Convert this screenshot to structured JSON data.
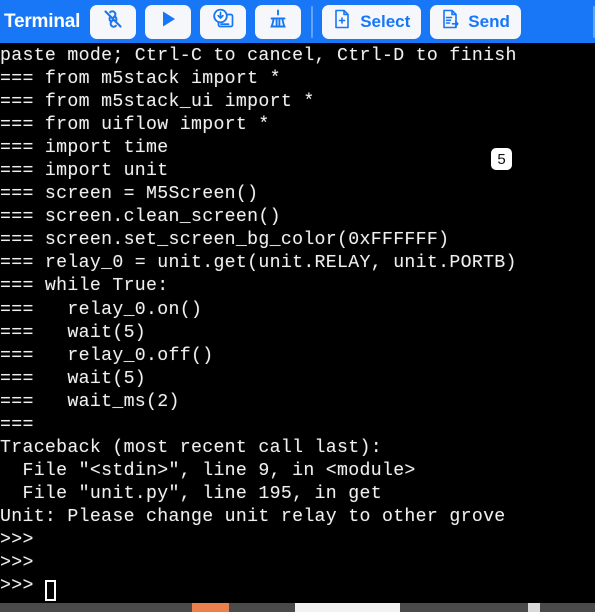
{
  "toolbar": {
    "title": "Terminal",
    "buttons": [
      {
        "name": "disconnect-button",
        "icon": "broken-link-icon",
        "label": ""
      },
      {
        "name": "run-button",
        "icon": "play-icon",
        "label": ""
      },
      {
        "name": "download-button",
        "icon": "download-to-device-icon",
        "label": ""
      },
      {
        "name": "clear-button",
        "icon": "broom-icon",
        "label": ""
      },
      {
        "name": "select-button",
        "icon": "file-plus-icon",
        "label": "Select"
      },
      {
        "name": "send-button",
        "icon": "file-send-icon",
        "label": "Send"
      }
    ],
    "select_label": "Select",
    "send_label": "Send",
    "accent_color": "#1877f7",
    "button_bg_color": "#f5f7fa",
    "divider_color": "#66a4f9"
  },
  "terminal": {
    "background_color": "#000000",
    "text_color": "#f0f0f0",
    "content": "paste mode; Ctrl-C to cancel, Ctrl-D to finish\n=== from m5stack import *\n=== from m5stack_ui import *\n=== from uiflow import *\n=== import time\n=== import unit\n=== screen = M5Screen()\n=== screen.clean_screen()\n=== screen.set_screen_bg_color(0xFFFFFF)\n=== relay_0 = unit.get(unit.RELAY, unit.PORTB)\n=== while True:\n===   relay_0.on()\n===   wait(5)\n===   relay_0.off()\n===   wait(5)\n===   wait_ms(2)\n===\nTraceback (most recent call last):\n  File \"<stdin>\", line 9, in <module>\n  File \"unit.py\", line 195, in get\nUnit: Please change unit relay to other grove\n>>>\n>>>\n>>> ",
    "cursor_visible": true,
    "badge": "5"
  },
  "scrollbar": {
    "track_color": "#4a4a4a",
    "segment_orange_color": "#e8824a",
    "segment_white_color": "#f2f2f2"
  }
}
